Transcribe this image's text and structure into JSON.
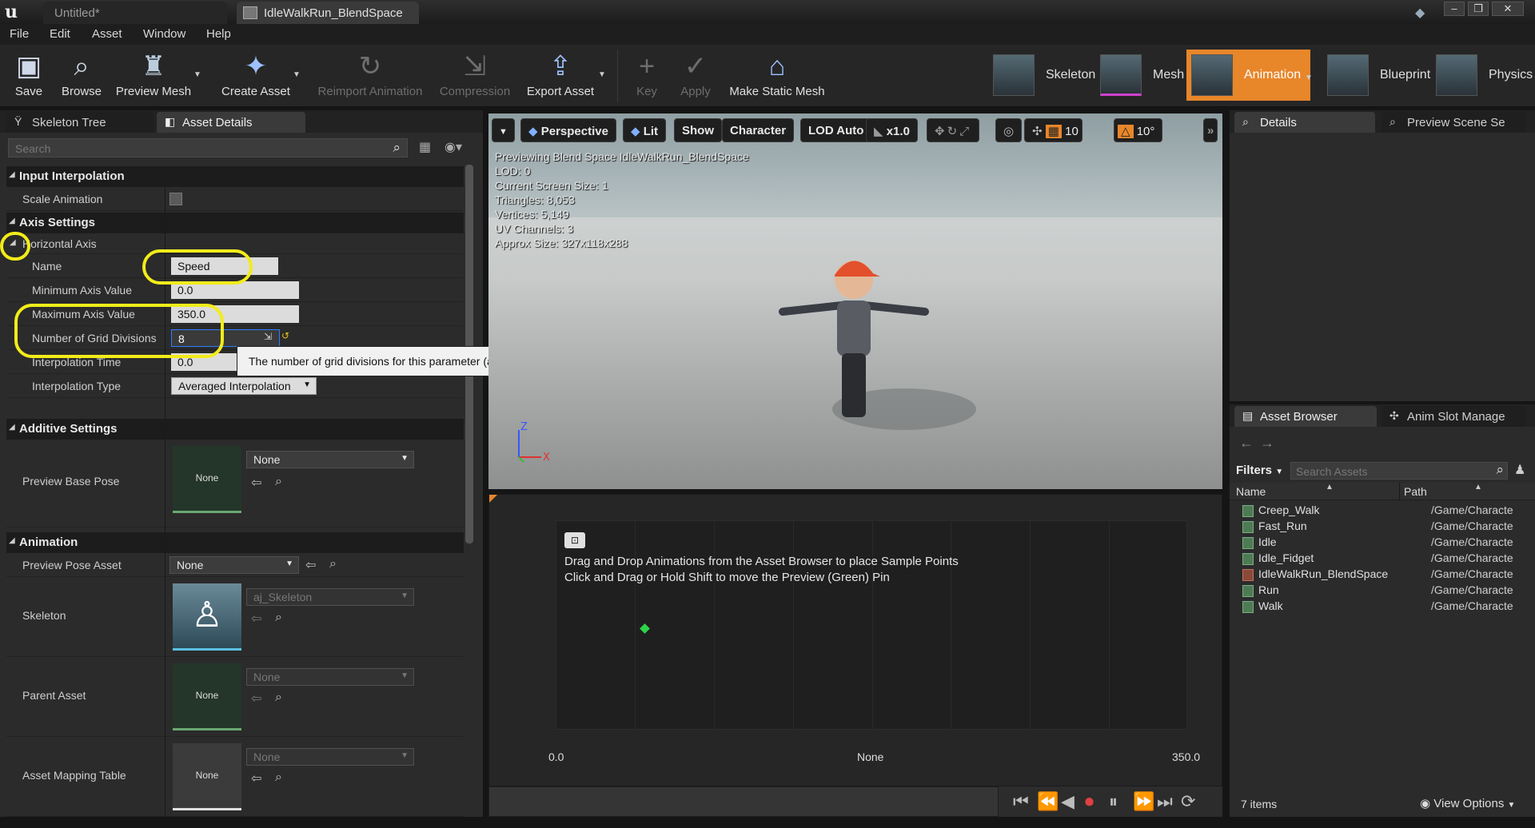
{
  "titlebar": {
    "tabs": [
      "Untitled*",
      "IdleWalkRun_BlendSpace"
    ]
  },
  "menu": [
    "File",
    "Edit",
    "Asset",
    "Window",
    "Help"
  ],
  "toolbar": {
    "save": "Save",
    "browse": "Browse",
    "preview_mesh": "Preview Mesh",
    "create_asset": "Create Asset",
    "reimport": "Reimport Animation",
    "compression": "Compression",
    "export": "Export Asset",
    "key": "Key",
    "apply": "Apply",
    "make_static": "Make Static Mesh"
  },
  "modes": {
    "skeleton": "Skeleton",
    "mesh": "Mesh",
    "animation": "Animation",
    "blueprint": "Blueprint",
    "physics": "Physics"
  },
  "left_panel": {
    "tabs": [
      "Skeleton Tree",
      "Asset Details"
    ],
    "search_placeholder": "Search",
    "input_interpolation": {
      "title": "Input Interpolation",
      "scale_animation": "Scale Animation"
    },
    "axis_settings": {
      "title": "Axis Settings",
      "horizontal_axis": "Horizontal Axis",
      "name_label": "Name",
      "name_value": "Speed",
      "min_label": "Minimum Axis Value",
      "min_value": "0.0",
      "max_label": "Maximum Axis Value",
      "max_value": "350.0",
      "grid_label": "Number of Grid Divisions",
      "grid_value": "8",
      "interp_time_label": "Interpolation Time",
      "interp_time_value": "0.0",
      "interp_type_label": "Interpolation Type",
      "interp_type_value": "Averaged Interpolation"
    },
    "tooltip": "The number of grid divisions for this parameter (axis).",
    "additive": {
      "title": "Additive Settings",
      "preview_base_pose": "Preview Base Pose",
      "thumb": "None",
      "combo": "None"
    },
    "animation": {
      "title": "Animation",
      "preview_pose_asset": "Preview Pose Asset",
      "preview_pose_value": "None",
      "skeleton": "Skeleton",
      "skeleton_value": "aj_Skeleton",
      "parent_asset": "Parent Asset",
      "parent_thumb": "None",
      "parent_value": "None",
      "mapping": "Asset Mapping Table",
      "mapping_thumb": "None",
      "mapping_value": "None"
    }
  },
  "viewport": {
    "perspective": "Perspective",
    "lit": "Lit",
    "show": "Show",
    "character": "Character",
    "lod": "LOD Auto",
    "speed": "x1.0",
    "grid": "10",
    "angle": "10°",
    "stats": [
      "Previewing Blend Space IdleWalkRun_BlendSpace",
      "LOD: 0",
      "Current Screen Size: 1",
      "Triangles: 8,053",
      "Vertices: 5,149",
      "UV Channels: 3",
      "Approx Size: 327x118x288"
    ]
  },
  "blendspace": {
    "line1": "Drag and Drop Animations from the Asset Browser to place Sample Points",
    "line2": "Click and Drag or Hold Shift to move the Preview (Green) Pin",
    "min": "0.0",
    "axis": "None",
    "max": "350.0"
  },
  "right_panel": {
    "tabs": [
      "Details",
      "Preview Scene Se"
    ],
    "browser_tabs": [
      "Asset Browser",
      "Anim Slot Manage"
    ],
    "filters": "Filters",
    "search_placeholder": "Search Assets",
    "col_name": "Name",
    "col_path": "Path",
    "assets": [
      {
        "name": "Creep_Walk",
        "path": "/Game/Characte"
      },
      {
        "name": "Fast_Run",
        "path": "/Game/Characte"
      },
      {
        "name": "Idle",
        "path": "/Game/Characte"
      },
      {
        "name": "Idle_Fidget",
        "path": "/Game/Characte"
      },
      {
        "name": "IdleWalkRun_BlendSpace",
        "path": "/Game/Characte"
      },
      {
        "name": "Run",
        "path": "/Game/Characte"
      },
      {
        "name": "Walk",
        "path": "/Game/Characte"
      }
    ],
    "count": "7 items",
    "view_options": "View Options"
  },
  "colors": {
    "accent": "#e8862a",
    "highlight": "#f2ec1a",
    "preview_pin": "#2fd34a"
  }
}
